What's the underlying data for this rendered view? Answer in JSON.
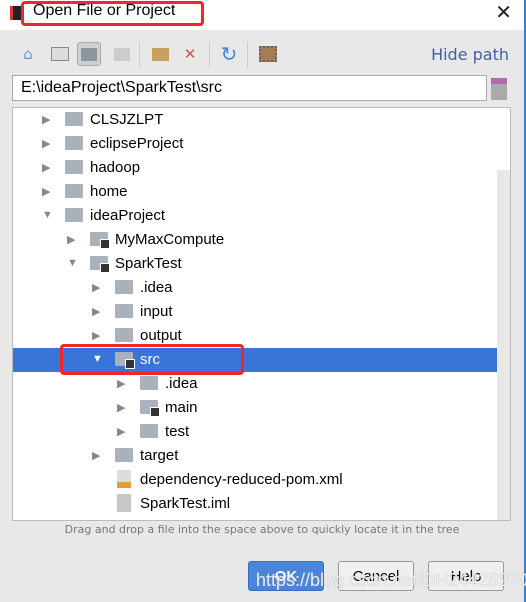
{
  "window": {
    "title": "Open File or Project",
    "close_icon": "close-icon"
  },
  "toolbar": {
    "buttons": [
      "home-icon",
      "desktop-icon",
      "project-folder-icon",
      "module-folder-icon",
      "new-folder-icon",
      "delete-icon",
      "refresh-icon",
      "show-hidden-icon"
    ],
    "hide_path": "Hide path"
  },
  "path": {
    "value": "E:\\ideaProject\\SparkTest\\src"
  },
  "tree": {
    "rows": [
      {
        "label": "CLSJZLPT",
        "level": 0,
        "expanded": false,
        "type": "folder"
      },
      {
        "label": "eclipseProject",
        "level": 0,
        "expanded": false,
        "type": "folder"
      },
      {
        "label": "hadoop",
        "level": 0,
        "expanded": false,
        "type": "folder"
      },
      {
        "label": "home",
        "level": 0,
        "expanded": false,
        "type": "folder"
      },
      {
        "label": "ideaProject",
        "level": 0,
        "expanded": true,
        "type": "folder"
      },
      {
        "label": "MyMaxCompute",
        "level": 1,
        "expanded": false,
        "type": "module"
      },
      {
        "label": "SparkTest",
        "level": 1,
        "expanded": true,
        "type": "module"
      },
      {
        "label": ".idea",
        "level": 2,
        "expanded": false,
        "type": "folder"
      },
      {
        "label": "input",
        "level": 2,
        "expanded": false,
        "type": "folder"
      },
      {
        "label": "output",
        "level": 2,
        "expanded": false,
        "type": "folder"
      },
      {
        "label": "src",
        "level": 2,
        "expanded": true,
        "type": "module",
        "selected": true
      },
      {
        "label": ".idea",
        "level": 3,
        "expanded": false,
        "type": "folder"
      },
      {
        "label": "main",
        "level": 3,
        "expanded": false,
        "type": "module"
      },
      {
        "label": "test",
        "level": 3,
        "expanded": false,
        "type": "folder"
      },
      {
        "label": "target",
        "level": 2,
        "expanded": false,
        "type": "folder"
      },
      {
        "label": "dependency-reduced-pom.xml",
        "level": 2,
        "type": "xml"
      },
      {
        "label": "SparkTest.iml",
        "level": 2,
        "type": "file"
      }
    ]
  },
  "hint": "Drag and drop a file into the space above to quickly locate it in the tree",
  "buttons": {
    "ok": "OK",
    "cancel": "Cancel",
    "help": "Help"
  },
  "watermark": "https://blog.csdn.net/DH2442897094",
  "colors": {
    "selection": "#3875d7",
    "annotation": "#f0262a",
    "link": "#3f5fa8"
  }
}
